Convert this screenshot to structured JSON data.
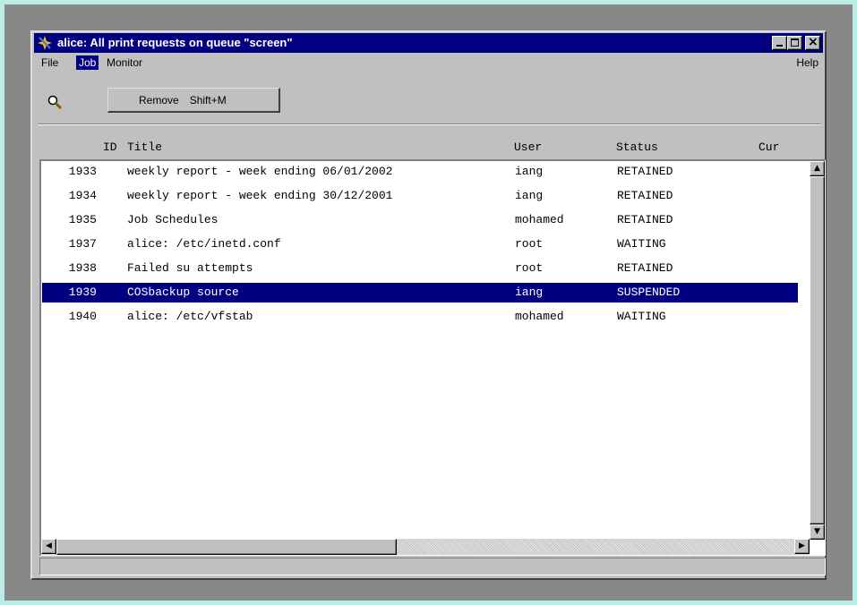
{
  "window": {
    "title": "alice: All print requests on queue \"screen\"",
    "icon": "printer-sparkle-icon"
  },
  "menubar": {
    "file": "File",
    "job": "Job",
    "monitor": "Monitor",
    "help": "Help"
  },
  "job_menu": {
    "items": [
      {
        "label": "Remove",
        "shortcut": "Shift+M"
      }
    ]
  },
  "toolbar": {
    "find_icon": "magnifier-icon"
  },
  "columns": {
    "id": "ID",
    "title": "Title",
    "user": "User",
    "status": "Status",
    "current": "Cur"
  },
  "jobs": [
    {
      "id": "1933",
      "title": "weekly report - week ending 06/01/2002",
      "user": "iang",
      "status": "RETAINED"
    },
    {
      "id": "1934",
      "title": "weekly report - week ending 30/12/2001",
      "user": "iang",
      "status": "RETAINED"
    },
    {
      "id": "1935",
      "title": "Job Schedules",
      "user": "mohamed",
      "status": "RETAINED"
    },
    {
      "id": "1937",
      "title": "alice: /etc/inetd.conf",
      "user": "root",
      "status": "WAITING"
    },
    {
      "id": "1938",
      "title": "Failed su attempts",
      "user": "root",
      "status": "RETAINED"
    },
    {
      "id": "1939",
      "title": "COSbackup source",
      "user": "iang",
      "status": "SUSPENDED"
    },
    {
      "id": "1940",
      "title": "alice: /etc/vfstab",
      "user": "mohamed",
      "status": "WAITING"
    }
  ],
  "selected_row": 5,
  "statusbar": {
    "text": ""
  },
  "colors": {
    "titlebar": "#000080",
    "selection": "#000080",
    "window_face": "#c0c0c0",
    "backdrop": "#b9ede4"
  }
}
